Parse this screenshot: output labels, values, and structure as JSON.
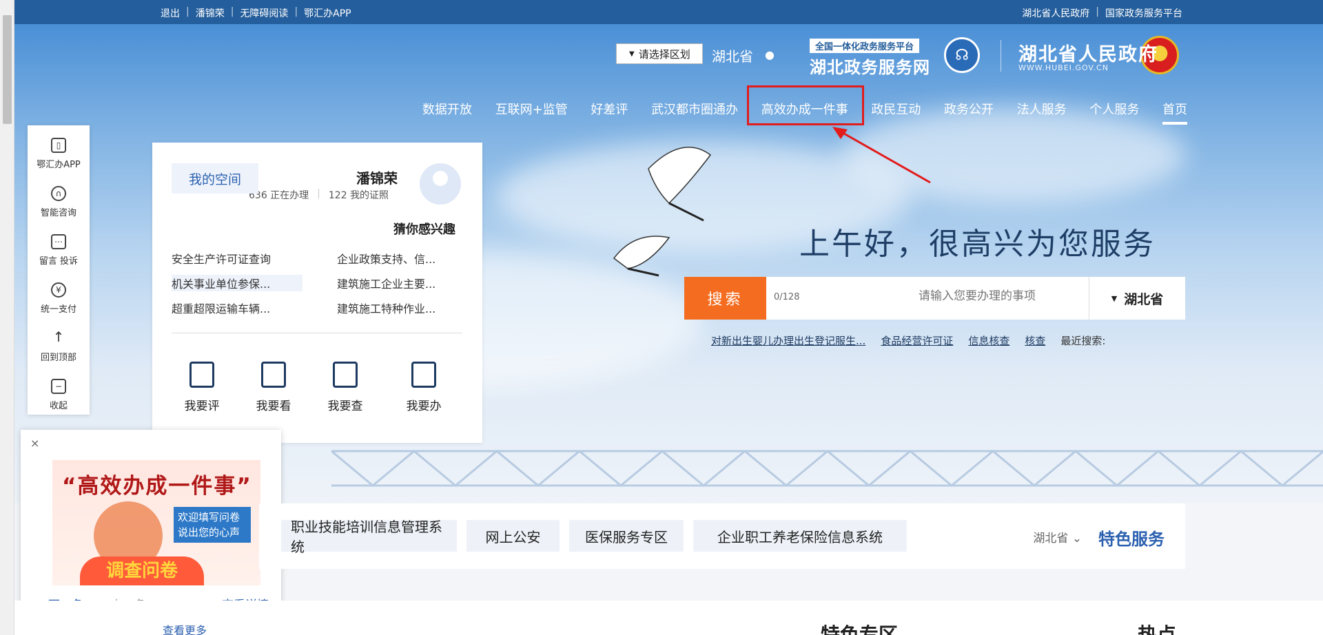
{
  "topbar": {
    "left_items": [
      "退出",
      "潘锦荣",
      "无障碍阅读",
      "鄂汇办APP"
    ],
    "right_items": [
      "湖北省人民政府",
      "国家政务服务平台"
    ]
  },
  "header": {
    "site_name": "湖北省人民政府",
    "site_domain": "WWW.HUBEI.GOV.CN",
    "platform_tag": "全国一体化政务服务平台",
    "platform_name": "湖北政务服务网",
    "location": "湖北省",
    "region_select": "请选择区划"
  },
  "nav": {
    "items": [
      "数据开放",
      "互联网+监管",
      "好差评",
      "武汉都市圈通办",
      "高效办成一件事",
      "政民互动",
      "政务公开",
      "法人服务",
      "个人服务",
      "首页"
    ]
  },
  "hero": {
    "greeting": "上午好，很高兴为您服务",
    "search": {
      "button": "搜索",
      "count": "0/128",
      "placeholder": "请输入您要办理的事项",
      "province": "湖北省"
    },
    "recent_label": "最近搜索:",
    "recent": [
      "对新出生婴儿办理出生登记服生...",
      "食品经营许可证",
      "信息核查",
      "核查"
    ]
  },
  "toolbar": {
    "items": [
      "鄂汇办APP",
      "智能咨询",
      "留言 投诉",
      "统一支付",
      "回到顶部",
      "收起"
    ]
  },
  "user_card": {
    "name": "潘锦荣",
    "stats": [
      "636 正在办理",
      "122 我的证照"
    ],
    "space_button": "我的空间",
    "guess_title": "猜你感兴趣",
    "guess_rows": [
      [
        "安全生产许可证查询",
        "企业政策支持、信..."
      ],
      [
        "机关事业单位参保...",
        "建筑施工企业主要..."
      ],
      [
        "超重超限运输车辆...",
        "建筑施工特种作业..."
      ]
    ],
    "quick_actions": [
      "我要评",
      "我要看",
      "我要查",
      "我要办"
    ]
  },
  "popup": {
    "close": "×",
    "banner_title": "“高效办成一件事”",
    "banner_box": "欢迎填写问卷说出您的心声",
    "banner_cta": "调查问卷",
    "links": [
      "下一条",
      "上一条",
      "查看详情"
    ]
  },
  "featured": {
    "title": "特色服务",
    "province": "湖北省",
    "items": [
      "企业职工养老保险信息系统",
      "医保服务专区",
      "网上公安",
      "职业技能培训信息管理系统"
    ]
  },
  "bottom": {
    "headings": [
      "热点",
      "特色专区"
    ],
    "more": "查看更多"
  }
}
